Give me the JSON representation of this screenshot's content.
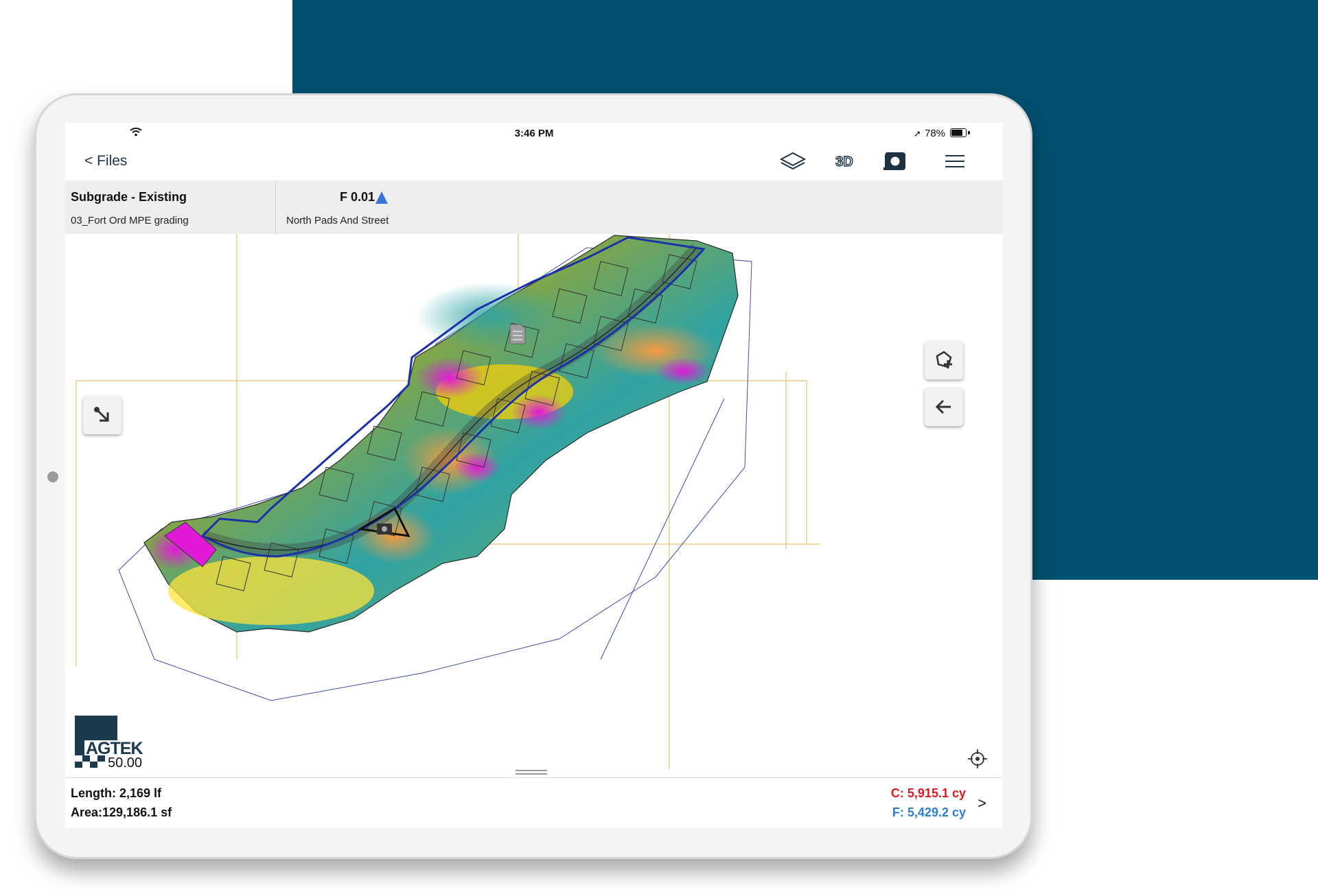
{
  "colors": {
    "brand_background": "#00506f",
    "cut": "#e0171f",
    "fill": "#2a7fd4",
    "boundary": "#1a2fa8",
    "heatmap": [
      "#2fa3a5",
      "#8fa63a",
      "#e8e82a",
      "#ffd200",
      "#ff9a3c",
      "#e11ad8"
    ]
  },
  "status_bar": {
    "time": "3:46 PM",
    "battery": "78%",
    "icons": [
      "wifi-icon",
      "location-arrow-icon",
      "battery-icon"
    ]
  },
  "nav": {
    "back_label": "< Files",
    "icons": [
      "layers-icon",
      "3d-icon",
      "tape-measure-icon",
      "menu-icon"
    ],
    "three_d_label": "3D"
  },
  "info": {
    "surface": "Subgrade - Existing",
    "project": "03_Fort Ord MPE grading",
    "elevation": "F 0.01",
    "area_name": "North Pads And Street"
  },
  "map": {
    "tools": [
      "import-arrow-icon",
      "add-shape-icon",
      "back-arrow-icon",
      "document-icon",
      "camera-icon",
      "locate-icon"
    ],
    "logo_text": "AGTEK",
    "scale": "50.00"
  },
  "summary": {
    "length": "Length: 2,169 lf",
    "area": "Area:129,186.1  sf",
    "cut": "C: 5,915.1 cy",
    "fill": "F: 5,429.2 cy",
    "chevron": ">"
  }
}
